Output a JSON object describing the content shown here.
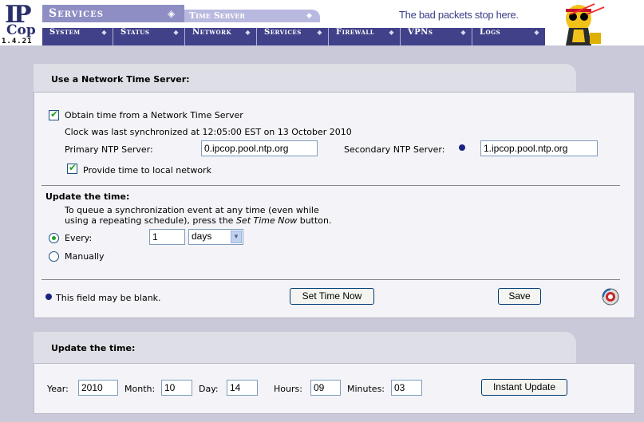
{
  "header": {
    "logo_text_ip": "IP",
    "logo_text_cop": "Cop",
    "version": "1.4.21",
    "section_title": "Services",
    "sub_title": "Time Server",
    "tagline": "The bad packets stop here.",
    "nav_tabs": [
      {
        "label": "System"
      },
      {
        "label": "Status"
      },
      {
        "label": "Network"
      },
      {
        "label": "Services"
      },
      {
        "label": "Firewall"
      },
      {
        "label": "VPNs"
      },
      {
        "label": "Logs"
      }
    ]
  },
  "ntp_panel": {
    "title": "Use a Network Time Server:",
    "obtain_label": "Obtain time from a Network Time Server",
    "obtain_checked": true,
    "last_sync": "Clock was last synchronized at 12:05:00 EST on 13 October 2010",
    "primary_label": "Primary NTP Server:",
    "primary_value": "0.ipcop.pool.ntp.org",
    "secondary_label": "Secondary NTP Server:",
    "secondary_value": "1.ipcop.pool.ntp.org",
    "provide_label": "Provide time to local network",
    "provide_checked": true,
    "update_heading": "Update the time:",
    "update_desc_line1": "To queue a synchronization event at any time (even while",
    "update_desc_line2_a": "using a repeating schedule), press the ",
    "update_desc_line2_em": "Set Time Now",
    "update_desc_line2_b": " button.",
    "every_label": "Every:",
    "every_value": "1",
    "every_unit": "days",
    "manually_label": "Manually",
    "blank_note": "This field may be blank.",
    "set_time_button": "Set Time Now",
    "save_button": "Save"
  },
  "update_panel": {
    "title": "Update the time:",
    "year_label": "Year:",
    "year_value": "2010",
    "month_label": "Month:",
    "month_value": "10",
    "day_label": "Day:",
    "day_value": "14",
    "hours_label": "Hours:",
    "hours_value": "09",
    "minutes_label": "Minutes:",
    "minutes_value": "03",
    "instant_button": "Instant Update"
  },
  "colors": {
    "nav_bg": "#41418a",
    "section_bg": "#8e8ec4",
    "check_green": "#21a121",
    "page_bg": "#c9c9d9"
  }
}
